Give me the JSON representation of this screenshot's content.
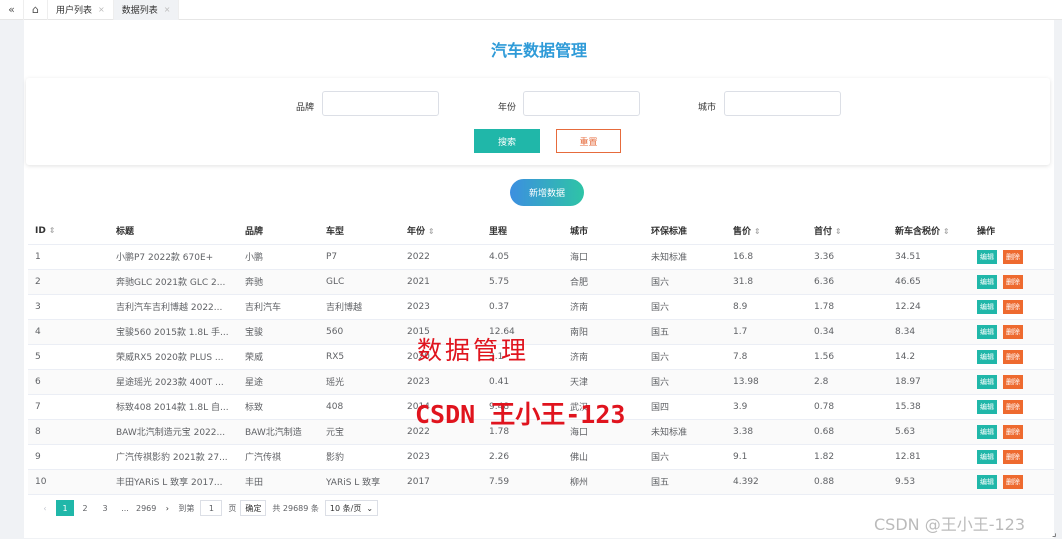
{
  "topbar": {
    "collapse_icon": "double-chevron-left-icon",
    "home_icon": "home-icon",
    "tabs": [
      {
        "label": "用户列表"
      },
      {
        "label": "数据列表"
      }
    ],
    "close_glyph": "×"
  },
  "page_title": "汽车数据管理",
  "filters": {
    "brand_label": "品牌",
    "year_label": "年份",
    "city_label": "城市",
    "brand_value": "",
    "year_value": "",
    "city_value": "",
    "search_label": "搜索",
    "reset_label": "重置"
  },
  "add_button": "新增数据",
  "table": {
    "headers": [
      "ID",
      "标题",
      "品牌",
      "车型",
      "年份",
      "里程",
      "城市",
      "环保标准",
      "售价",
      "首付",
      "新车含税价",
      "操作"
    ],
    "edit_label": "编辑",
    "delete_label": "删除",
    "rows": [
      [
        "1",
        "小鹏P7 2022款 670E+",
        "小鹏",
        "P7",
        "2022",
        "4.05",
        "海口",
        "未知标准",
        "16.8",
        "3.36",
        "34.51"
      ],
      [
        "2",
        "奔驰GLC 2021款 GLC 2...",
        "奔驰",
        "GLC",
        "2021",
        "5.75",
        "合肥",
        "国六",
        "31.8",
        "6.36",
        "46.65"
      ],
      [
        "3",
        "吉利汽车吉利博越 2022...",
        "吉利汽车",
        "吉利博越",
        "2023",
        "0.37",
        "济南",
        "国六",
        "8.9",
        "1.78",
        "12.24"
      ],
      [
        "4",
        "宝骏560 2015款 1.8L 手...",
        "宝骏",
        "560",
        "2015",
        "12.64",
        "南阳",
        "国五",
        "1.7",
        "0.34",
        "8.34"
      ],
      [
        "5",
        "荣威RX5 2020款 PLUS ...",
        "荣威",
        "RX5",
        "2020",
        "3.1",
        "济南",
        "国六",
        "7.8",
        "1.56",
        "14.2"
      ],
      [
        "6",
        "星途瑶光 2023款 400T ...",
        "星途",
        "瑶光",
        "2023",
        "0.41",
        "天津",
        "国六",
        "13.98",
        "2.8",
        "18.97"
      ],
      [
        "7",
        "标致408 2014款 1.8L 自...",
        "标致",
        "408",
        "2014",
        "9.48",
        "武汉",
        "国四",
        "3.9",
        "0.78",
        "15.38"
      ],
      [
        "8",
        "BAW北汽制造元宝 2022...",
        "BAW北汽制造",
        "元宝",
        "2022",
        "1.78",
        "海口",
        "未知标准",
        "3.38",
        "0.68",
        "5.63"
      ],
      [
        "9",
        "广汽传祺影豹 2021款 27...",
        "广汽传祺",
        "影豹",
        "2023",
        "2.26",
        "佛山",
        "国六",
        "9.1",
        "1.82",
        "12.81"
      ],
      [
        "10",
        "丰田YARiS L 致享 2017...",
        "丰田",
        "YARiS L 致享",
        "2017",
        "7.59",
        "柳州",
        "国五",
        "4.392",
        "0.88",
        "9.53"
      ]
    ]
  },
  "pagination": {
    "prev": "‹",
    "pages": [
      "1",
      "2",
      "3",
      "...",
      "2969"
    ],
    "next": "›",
    "goto_label": "到第",
    "goto_value": "1",
    "page_unit": "页",
    "confirm_label": "确定",
    "total_label": "共 29689 条",
    "page_size_label": "10 条/页"
  },
  "watermarks": {
    "overlay_title": "数据管理",
    "overlay_author": "CSDN 王小王-123",
    "corner": "CSDN @王小王-123"
  },
  "colors": {
    "accent": "#20b7a9",
    "danger": "#ee6a2f",
    "title": "#2f9bd8"
  }
}
